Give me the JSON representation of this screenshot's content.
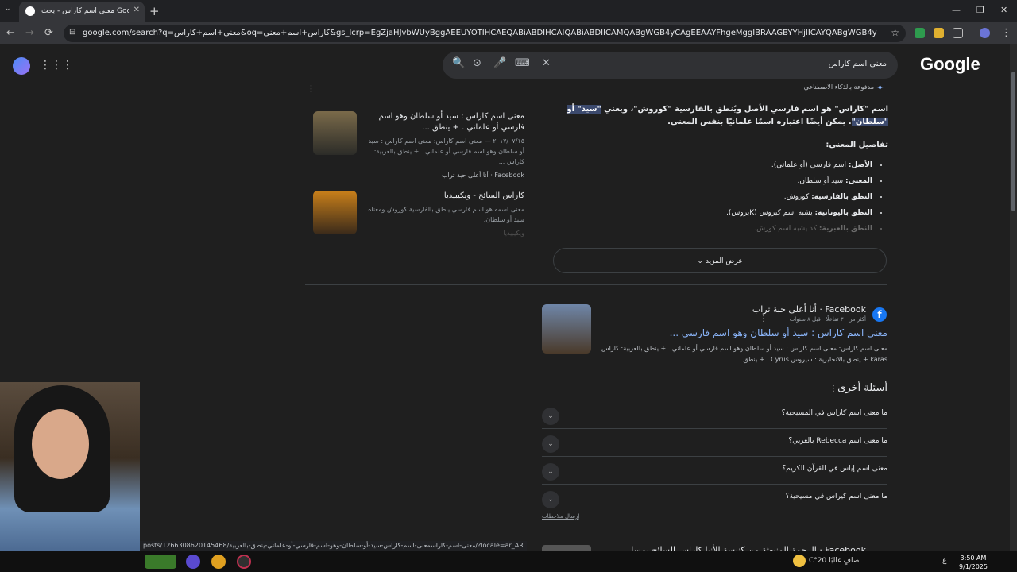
{
  "browser": {
    "tab_title": "معنى اسم كاراس - بحث Google",
    "tab_close": "✕",
    "new_tab": "+",
    "tab_list": "⌄",
    "url": "google.com/search?q=معنى+اسم+كاراس&oq=كاراس+اسم+معنى&gs_lcrp=EgZjaHJvbWUyBggAEEUYOTIHCAEQABiABDIHCAIQABiABDIICAMQABgWGB4yCAgEEAAYFhgeMggIBRAAGBYYHjIICAYQABgWGB4yCAgHEAAYFhgeMggICBAAGBYYHjIICAkQ",
    "back": "←",
    "forward": "→",
    "reload": "⟳",
    "star": "☆",
    "site_info": "⊟",
    "minimize": "—",
    "restore": "❐",
    "close": "✕",
    "menu": "⋮"
  },
  "search": {
    "logo": "Google",
    "query": "معنى اسم كاراس",
    "clear": "✕",
    "icons": {
      "search": "🔍",
      "lens": "⊙",
      "mic": "🎤",
      "keyboard": "⌨"
    }
  },
  "ai_overview": {
    "tag": "مدفوعة بالذكاء الاصطناعي",
    "spark": "✦",
    "text_part1": "اسم \"كاراس\" هو اسم فارسي الأصل ويُنطق بالفارسية \"كوروش\"، ويعني ",
    "text_highlight": "\"سيد\" أو \"سلطان\"",
    "text_part2": ". يمكن أيضًا اعتباره اسمًا علمانيًا بنفس المعنى.",
    "details_heading": "تفاصيل المعنى:",
    "bullets": [
      {
        "label": "الأصل:",
        "value": " اسم فارسي (أو علماني)."
      },
      {
        "label": "المعنى:",
        "value": " سيد أو سلطان."
      },
      {
        "label": "النطق بالفارسية:",
        "value": " كوروش."
      },
      {
        "label": "النطق باليونانية:",
        "value": " يشبه اسم كيروس (Kيروس)."
      },
      {
        "label": "النطق بالعبرية:",
        "value": " كذ يشبه اسم كورش."
      }
    ],
    "show_more": "عرض المزيد",
    "show_more_chevron": "⌄",
    "more_dots": "⋮"
  },
  "side_cards": [
    {
      "title": "معنى اسم كاراس : سيد أو سلطان وهو اسم فارسي أو علماني . + ينطق ...",
      "snippet": "٢٠١٧/٠٧/١٥ — معنى اسم كاراس: معنى اسم كاراس : سيد أو سلطان وهو اسم فارسي أو علماني . + ينطق بالعربية: كاراس ...",
      "source": "Facebook · أنا أعلى حبة تراب"
    },
    {
      "title": "كاراس السائح - ويكيبيديا",
      "snippet": "معنى اسمه هو اسم فارسي ينطق بالفارسية كوروش ومعناه سيد أو سلطان.",
      "source": "ويكيبيديا"
    }
  ],
  "result": {
    "site": "Facebook · أنا أعلى حبة تراب",
    "meta": "أكثر من ٣٠ تفاعلًا · قبل ٨ سنوات",
    "fb_letter": "f",
    "dots": "⋮",
    "title": "معنى اسم كاراس : سيد أو سلطان وهو اسم فارسي ...",
    "snippet": "معنى اسم كاراس: معنى اسم كاراس : سيد أو سلطان وهو اسم فارسي أو علماني . + ينطق بالعربية: كاراس karas + ينطق بالانجليزية : سيروس Cyrus . + ينطق ..."
  },
  "paa": {
    "heading": "أسئلة أخرى",
    "dots": "⋮",
    "chevron": "⌄",
    "questions": [
      "ما معنى اسم كاراس في المسيحية؟",
      "ما معنى اسم Rebecca بالعربي؟",
      "معنى اسم إياس في القرآن الكريم؟",
      "ما معنى اسم كيراس في مسيحية؟"
    ],
    "feedback": "إرسال ملاحظات"
  },
  "next_result": {
    "site": "Facebook · الرحمة المنبعثة من كنيسة الأنبا كاراس السائح بمسل"
  },
  "status_url": "posts/1266308620145468/معنى-اسم-كاراسمعنى-اسم-كاراس-سيد-أو-سلطان-وهو-اسم-فارسي-أو-علماني-ينطق-بالعربية/?locale=ar_AR",
  "taskbar": {
    "weather": "صافٍ غالبًا 20°C",
    "lang": "ع",
    "time": "3:50 AM",
    "date": "9/1/2025"
  }
}
